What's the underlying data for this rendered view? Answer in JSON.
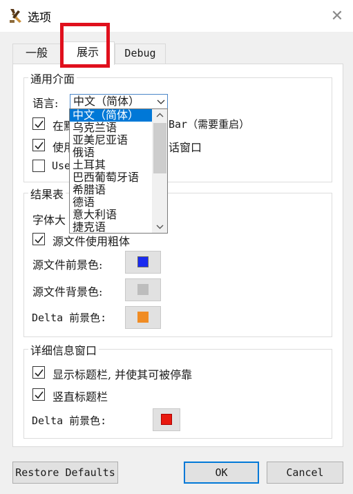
{
  "window": {
    "title": "选项",
    "close_glyph": "✕"
  },
  "tabs": [
    {
      "label": "一般"
    },
    {
      "label": "展示"
    },
    {
      "label": "Debug"
    }
  ],
  "general_ui": {
    "title": "通用介面",
    "language_label": "语言:",
    "language_value": "中文（简体）",
    "options": [
      {
        "label_start": "在默",
        "label_end": "Bar（需要重启）",
        "checked": true
      },
      {
        "label_start": "使用",
        "label_end": "话窗口",
        "checked": true
      },
      {
        "label_start": "Use",
        "checked": false
      }
    ]
  },
  "language_dropdown": {
    "items": [
      "中文（简体）",
      "乌克兰语",
      "亚美尼亚语",
      "俄语",
      "土耳其",
      "巴西葡萄牙语",
      "希腊语",
      "德语",
      "意大利语",
      "捷克语"
    ],
    "selected_index": 0
  },
  "results": {
    "title": "结果表",
    "font_size_label": "字体大",
    "bold_label": "源文件使用粗体",
    "bold_checked": true,
    "fg_label": "源文件前景色:",
    "bg_label": "源文件背景色:",
    "delta_label": "Delta 前景色:",
    "colors": {
      "source_fg": "#1a2bf0",
      "source_bg": "#bdbdbd",
      "delta_fg": "#f08c24"
    }
  },
  "details": {
    "title": "详细信息窗口",
    "show_titlebar_label": "显示标题栏, 并使其可被停靠",
    "show_titlebar_checked": true,
    "vertical_titlebar_label": "竖直标题栏",
    "vertical_titlebar_checked": true,
    "delta_label": "Delta 前景色:",
    "delta_color": "#e8190f"
  },
  "buttons": {
    "restore": "Restore Defaults",
    "ok": "OK",
    "cancel": "Cancel"
  },
  "accent": "#0078d7",
  "highlight_box_color": "#e0101d"
}
